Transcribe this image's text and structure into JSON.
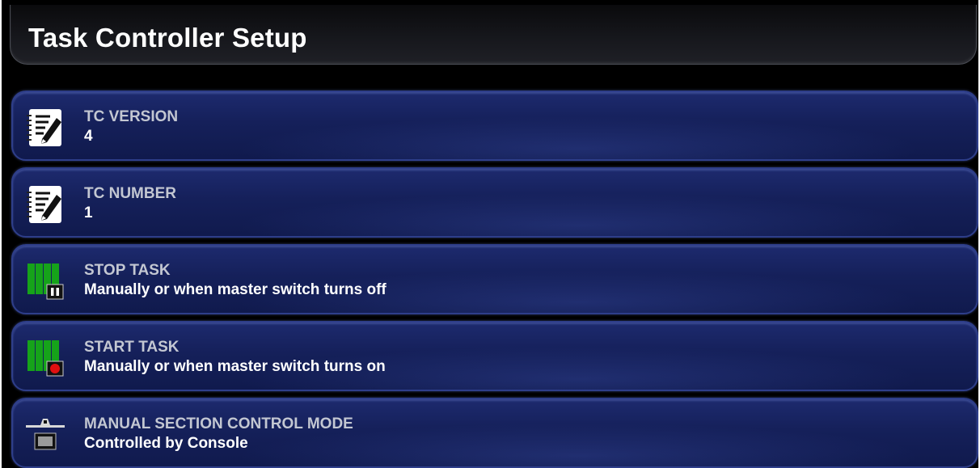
{
  "header": {
    "title": "Task Controller Setup"
  },
  "settings": [
    {
      "icon": "notepad-edit-icon",
      "label": "TC VERSION",
      "value": "4"
    },
    {
      "icon": "notepad-edit-icon",
      "label": "TC NUMBER",
      "value": "1"
    },
    {
      "icon": "stop-task-pause-icon",
      "label": "STOP TASK",
      "value": "Manually or when master switch turns off"
    },
    {
      "icon": "start-task-record-icon",
      "label": "START TASK",
      "value": "Manually or when master switch turns on"
    },
    {
      "icon": "boom-console-icon",
      "label": "MANUAL SECTION CONTROL MODE",
      "value": "Controlled by Console"
    }
  ],
  "colors": {
    "row_background": "#15205a",
    "row_border": "#2e3e8a",
    "section_green": "#16a31a",
    "record_red": "#e01010"
  }
}
